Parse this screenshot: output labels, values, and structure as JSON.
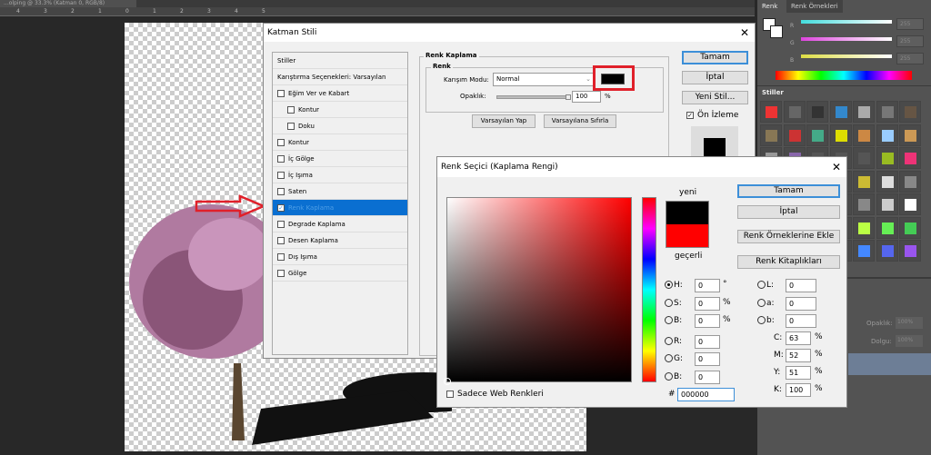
{
  "document": {
    "tab_title": "...olping @ 33.3% (Katman 0, RGB/8)",
    "ruler_ticks": [
      "4",
      "3",
      "2",
      "1",
      "0",
      "1",
      "2",
      "3",
      "4",
      "5"
    ]
  },
  "layer_style": {
    "title": "Katman Stili",
    "list": [
      {
        "label": "Stiller",
        "checkbox": false
      },
      {
        "label": "Karıştırma Seçenekleri: Varsayılan",
        "checkbox": false
      },
      {
        "label": "Eğim Ver ve Kabart",
        "checkbox": true,
        "checked": false
      },
      {
        "label": "Kontur",
        "checkbox": true,
        "checked": false,
        "indent": true
      },
      {
        "label": "Doku",
        "checkbox": true,
        "checked": false,
        "indent": true
      },
      {
        "label": "Kontur",
        "checkbox": true,
        "checked": false
      },
      {
        "label": "İç Gölge",
        "checkbox": true,
        "checked": false
      },
      {
        "label": "İç Işıma",
        "checkbox": true,
        "checked": false
      },
      {
        "label": "Saten",
        "checkbox": true,
        "checked": false
      },
      {
        "label": "Renk Kaplama",
        "checkbox": true,
        "checked": true,
        "selected": true
      },
      {
        "label": "Degrade Kaplama",
        "checkbox": true,
        "checked": false
      },
      {
        "label": "Desen Kaplama",
        "checkbox": true,
        "checked": false
      },
      {
        "label": "Dış Işıma",
        "checkbox": true,
        "checked": false
      },
      {
        "label": "Gölge",
        "checkbox": true,
        "checked": false
      }
    ],
    "group_title": "Renk Kaplama",
    "subgroup_title": "Renk",
    "blend_label": "Karışım Modu:",
    "blend_value": "Normal",
    "opacity_label": "Opaklık:",
    "opacity_value": "100",
    "opacity_unit": "%",
    "opacity_percent": 100,
    "overlay_color": "#000000",
    "highlight_color": "#e0202a",
    "make_default": "Varsayılan Yap",
    "reset_default": "Varsayılana Sıfırla",
    "ok": "Tamam",
    "cancel": "İptal",
    "new_style": "Yeni Stil...",
    "preview_label": "Ön İzleme",
    "preview_checked": true
  },
  "color_picker": {
    "title": "Renk Seçici (Kaplama Rengi)",
    "new_label": "yeni",
    "current_label": "geçerli",
    "new_color": "#000000",
    "current_color": "#ff0000",
    "ok": "Tamam",
    "cancel": "İptal",
    "add_swatch": "Renk Örneklerine Ekle",
    "libraries": "Renk Kitaplıkları",
    "fields": {
      "H": "0",
      "S": "0",
      "B": "0",
      "R": "0",
      "G": "0",
      "B2": "0",
      "L": "0",
      "a": "0",
      "b": "0",
      "C": "63",
      "M": "52",
      "Y": "51",
      "K": "100"
    },
    "labels": {
      "H": "H:",
      "S": "S:",
      "B": "B:",
      "R": "R:",
      "G": "G:",
      "B2": "B:",
      "L": "L:",
      "a": "a:",
      "b": "b:",
      "C": "C:",
      "M": "M:",
      "Y": "Y:",
      "K": "K:"
    },
    "deg": "°",
    "pct": "%",
    "hash": "#",
    "hex": "000000",
    "web_only": "Sadece Web Renkleri",
    "selected_radio": "H"
  },
  "color_panel": {
    "tabs": [
      "Renk",
      "Renk Örnekleri"
    ],
    "channels": [
      {
        "label": "R",
        "value": "255"
      },
      {
        "label": "G",
        "value": "255"
      },
      {
        "label": "B",
        "value": "255"
      }
    ]
  },
  "styles_panel": {
    "tab": "Stiller"
  },
  "layers_panel": {
    "opacity_label": "Opaklık:",
    "opacity_value": "100%",
    "fill_label": "Dolgu:",
    "fill_value": "100%"
  }
}
